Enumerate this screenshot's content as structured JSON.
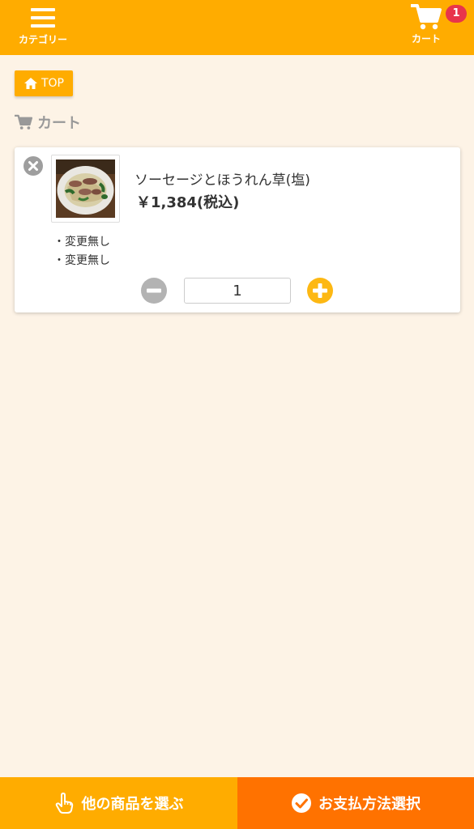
{
  "header": {
    "category_label": "カテゴリー",
    "cart_label": "カート",
    "cart_count": "1"
  },
  "nav": {
    "top_label": "TOP"
  },
  "section": {
    "title": "カート"
  },
  "cart_items": [
    {
      "name": "ソーセージとほうれん草(塩)",
      "price": "￥1,384(税込)",
      "options": [
        "・変更無し",
        "・変更無し"
      ],
      "quantity": "1"
    }
  ],
  "footer": {
    "continue_label": "他の商品を選ぶ",
    "checkout_label": "お支払方法選択"
  },
  "colors": {
    "primary": "#ffac00",
    "accent": "#ff7200",
    "badge": "#e8344b",
    "background": "#fdf3e6"
  }
}
